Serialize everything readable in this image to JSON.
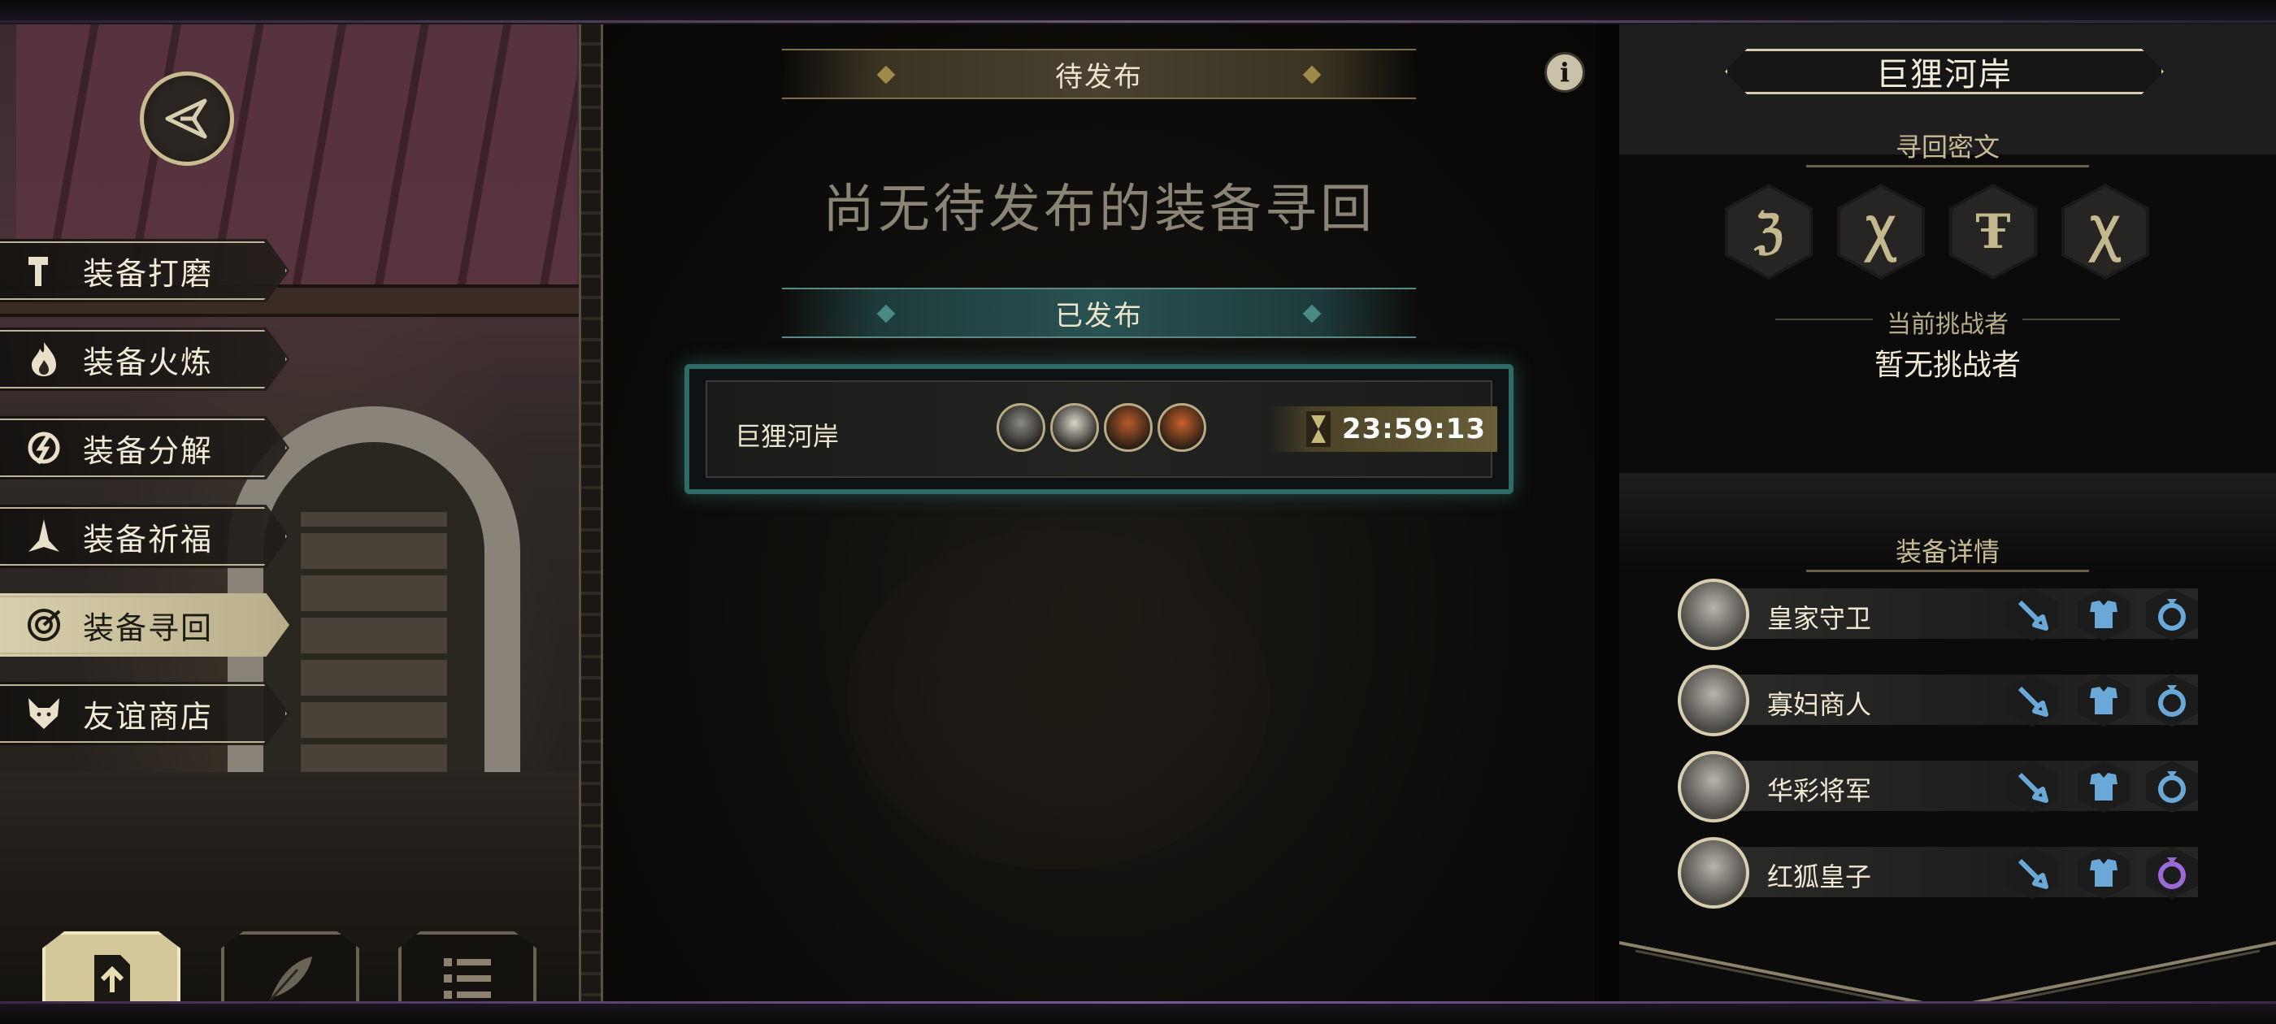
{
  "left": {
    "menu": [
      {
        "label": "装备打磨",
        "icon": "hammer-icon",
        "active": false
      },
      {
        "label": "装备火炼",
        "icon": "flame-icon",
        "active": false
      },
      {
        "label": "装备分解",
        "icon": "disassemble-icon",
        "active": false
      },
      {
        "label": "装备祈福",
        "icon": "pray-icon",
        "active": false
      },
      {
        "label": "装备寻回",
        "icon": "target-icon",
        "active": true
      },
      {
        "label": "友谊商店",
        "icon": "fox-icon",
        "active": false
      }
    ],
    "bottom_buttons": [
      {
        "icon": "upload-icon",
        "active": true
      },
      {
        "icon": "feather-icon",
        "active": false
      },
      {
        "icon": "list-icon",
        "active": false
      }
    ]
  },
  "center": {
    "pending_label": "待发布",
    "empty_message": "尚无待发布的装备寻回",
    "published_label": "已发布",
    "quest": {
      "name": "巨狸河岸",
      "timer": "23:59:13",
      "portrait_colors": [
        "#8a8a86",
        "#d8d4c8",
        "#b85a2a",
        "#c8602a"
      ]
    }
  },
  "right": {
    "title": "巨狸河岸",
    "cipher_heading": "寻回密文",
    "runes": [
      "ℨ",
      "Ꭓ",
      "Ŧ",
      "Ꭓ"
    ],
    "challenger_heading": "当前挑战者",
    "challenger_value": "暂无挑战者",
    "equip_heading": "装备详情",
    "equipment": [
      {
        "name": "皇家守卫",
        "ring_color": "#6aa8d8"
      },
      {
        "name": "寡妇商人",
        "ring_color": "#6aa8d8"
      },
      {
        "name": "华彩将军",
        "ring_color": "#6aa8d8"
      },
      {
        "name": "红狐皇子",
        "ring_color": "#9a6ad8"
      }
    ]
  },
  "colors": {
    "gold": "#c8bc90",
    "teal": "#2e6a68",
    "slot_blue": "#6aa8d8"
  }
}
